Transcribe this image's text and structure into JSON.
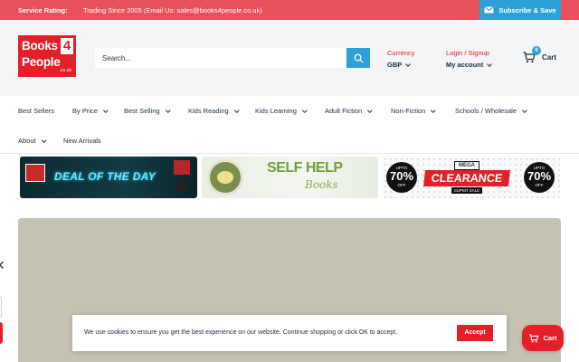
{
  "topbar": {
    "rating_label": "Service Rating:",
    "since_text": "Trading Since 2005 (Email Us: sales@books4people.co.uk)",
    "subscribe_label": "Subscribe & Save"
  },
  "header": {
    "logo": {
      "line1": "Books",
      "digit": "4",
      "line2": "People",
      "domain": ".co.uk"
    },
    "search": {
      "placeholder": "Search..."
    },
    "currency": {
      "label": "Currency",
      "value": "GBP"
    },
    "account": {
      "label": "Login / Signup",
      "value": "My account"
    },
    "cart": {
      "label": "Cart",
      "count": "0"
    }
  },
  "nav": {
    "items": [
      {
        "label": "Best Sellers"
      },
      {
        "label": "By Price"
      },
      {
        "label": "Best Selling"
      },
      {
        "label": "Kids Reading"
      },
      {
        "label": "Kids Learning"
      },
      {
        "label": "Adult Fiction"
      },
      {
        "label": "Non-Fiction"
      },
      {
        "label": "Schools / Wholesale"
      },
      {
        "label": "About"
      },
      {
        "label": "New Arrivals"
      }
    ]
  },
  "banners": {
    "deal": {
      "text": "DEAL OF THE DAY"
    },
    "selfhelp": {
      "title": "SELF HELP",
      "subtitle": "Books"
    },
    "clearance": {
      "mega": "MEGA",
      "title": "CLEARANCE",
      "tag": "SUPER SALE",
      "upto": "UPTO",
      "percent": "70%",
      "off": "OFF"
    }
  },
  "cookie": {
    "message": "We use cookies to ensure you get the best experience on our website. Continue shopping or click OK to accept.",
    "accept_label": "Accept"
  },
  "floating_cart": {
    "label": "Cart"
  },
  "colors": {
    "accent_red": "#e3202a",
    "topbar_red": "#e8505b",
    "accent_blue": "#2ca0d8",
    "text_dark": "#1e2d3d"
  }
}
